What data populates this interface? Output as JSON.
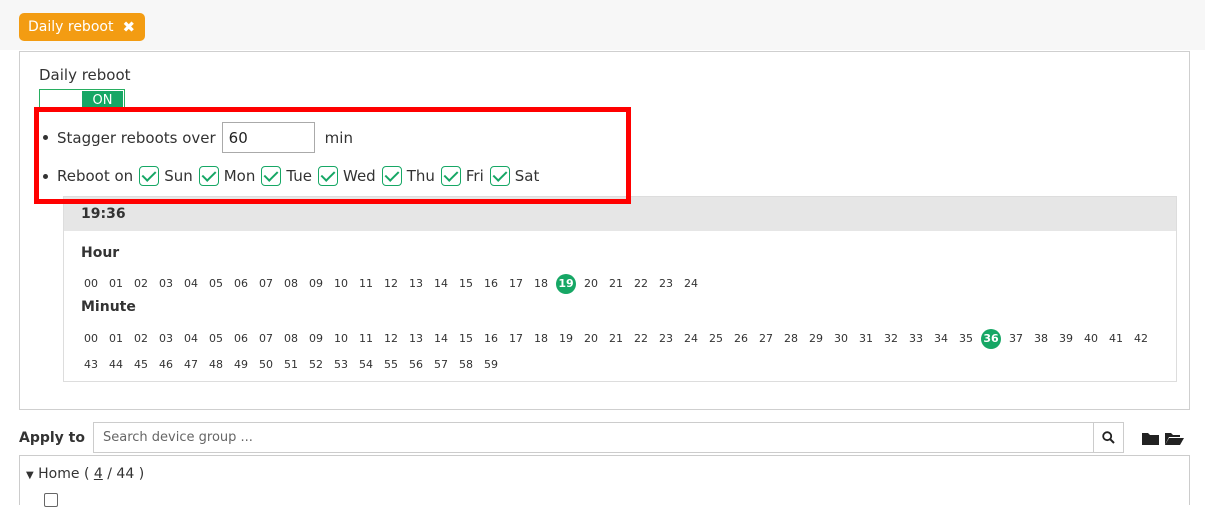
{
  "tab": {
    "label": "Daily reboot",
    "close_icon": "close-icon"
  },
  "panel": {
    "title": "Daily reboot",
    "toggle_label": "ON",
    "stagger": {
      "prefix": "Stagger reboots over",
      "value": "60",
      "unit": "min"
    },
    "reboot_on": {
      "label": "Reboot on",
      "days": [
        {
          "label": "Sun",
          "checked": true
        },
        {
          "label": "Mon",
          "checked": true
        },
        {
          "label": "Tue",
          "checked": true
        },
        {
          "label": "Wed",
          "checked": true
        },
        {
          "label": "Thu",
          "checked": true
        },
        {
          "label": "Fri",
          "checked": true
        },
        {
          "label": "Sat",
          "checked": true
        }
      ]
    },
    "time": {
      "display": "19:36",
      "hour_label": "Hour",
      "minute_label": "Minute",
      "hours": [
        "00",
        "01",
        "02",
        "03",
        "04",
        "05",
        "06",
        "07",
        "08",
        "09",
        "10",
        "11",
        "12",
        "13",
        "14",
        "15",
        "16",
        "17",
        "18",
        "19",
        "20",
        "21",
        "22",
        "23",
        "24"
      ],
      "selected_hour": "19",
      "minutes": [
        "00",
        "01",
        "02",
        "03",
        "04",
        "05",
        "06",
        "07",
        "08",
        "09",
        "10",
        "11",
        "12",
        "13",
        "14",
        "15",
        "16",
        "17",
        "18",
        "19",
        "20",
        "21",
        "22",
        "23",
        "24",
        "25",
        "26",
        "27",
        "28",
        "29",
        "30",
        "31",
        "32",
        "33",
        "34",
        "35",
        "36",
        "37",
        "38",
        "39",
        "40",
        "41",
        "42",
        "43",
        "44",
        "45",
        "46",
        "47",
        "48",
        "49",
        "50",
        "51",
        "52",
        "53",
        "54",
        "55",
        "56",
        "57",
        "58",
        "59"
      ],
      "selected_minute": "36"
    }
  },
  "apply": {
    "label": "Apply to",
    "search_placeholder": "Search device group ...",
    "search_icon": "search-icon",
    "folder_icons": [
      "folder-closed-icon",
      "folder-open-icon"
    ]
  },
  "tree": {
    "root_label": "Home",
    "count_selected": "4",
    "count_total": "44"
  },
  "colors": {
    "accent_green": "#16a765",
    "tag_orange": "#f39c12",
    "highlight_red": "#ff0000"
  }
}
